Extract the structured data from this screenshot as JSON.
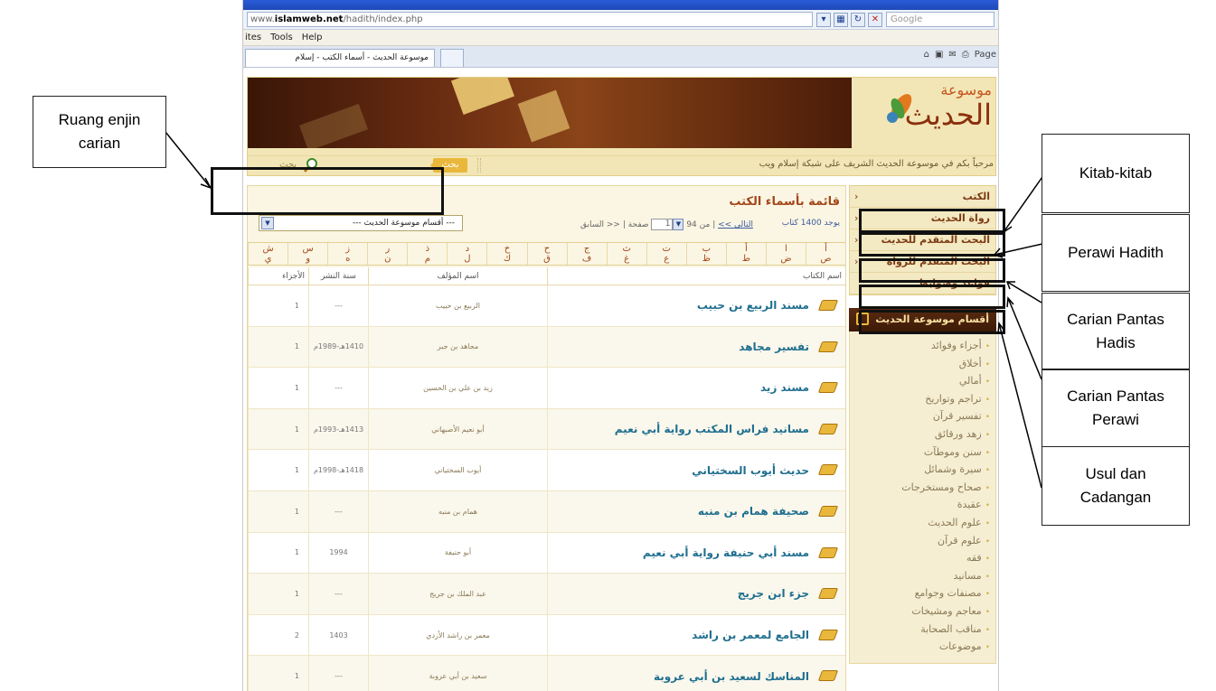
{
  "browser": {
    "url_prefix": "www.",
    "url_domain": "islamweb.net",
    "url_path": "/hadith/index.php",
    "search_placeholder": "Google",
    "menu": [
      "ites",
      "Tools",
      "Help"
    ],
    "tab_title": "موسوعة الحديث - أسماء الكتب - إسلام",
    "toolbar_page": "Page"
  },
  "header": {
    "logo_small": "موسوعة",
    "logo_big": "الحديث",
    "welcome": "مرحباً بكم في موسوعة الحديث الشريف على شبكة إسلام ويب",
    "search_button": "بحث",
    "search_field": "بحث"
  },
  "sidebar": {
    "items": [
      {
        "label": "الكتب"
      },
      {
        "label": "رواة الحديث"
      },
      {
        "label": "البحث المتقدم للحديث"
      },
      {
        "label": "البحث المتقدم للرواة"
      },
      {
        "label": "قواعد وضوابط"
      }
    ],
    "section_title": "أقسام موسوعة الحديث",
    "categories": [
      "أجزاء وفوائد",
      "أخلاق",
      "أمالي",
      "تراجم وتواريخ",
      "تفسير قرآن",
      "زهد ورقائق",
      "سنن وموطآت",
      "سيرة وشمائل",
      "صحاح ومستخرجات",
      "عقيدة",
      "علوم الحديث",
      "علوم قرآن",
      "فقه",
      "مسانيد",
      "مصنفات وجوامع",
      "معاجم ومشيخات",
      "مناقب الصحابة",
      "موضوعات"
    ]
  },
  "main": {
    "title": "قائمة بأسماء الكتب",
    "count": "يوجد 1400 كتاب",
    "pager": {
      "prev": "<< السابق",
      "page_label": "صفحة",
      "page_value": "1",
      "of": "من 94",
      "next": "التالي >>"
    },
    "category_select": "--- أقسام موسوعة الحديث ---",
    "alphabet_top": [
      "أ",
      "ا",
      "أ",
      "ب",
      "ت",
      "ث",
      "ج",
      "ح",
      "خ",
      "د",
      "ذ",
      "ر",
      "ز",
      "س",
      "ش"
    ],
    "alphabet_bottom": [
      "ص",
      "ض",
      "ط",
      "ظ",
      "ع",
      "غ",
      "ف",
      "ق",
      "ك",
      "ل",
      "م",
      "ن",
      "ه",
      "و",
      "ي"
    ],
    "columns": {
      "name": "اسم الكتاب",
      "author": "اسم المؤلف",
      "year": "سنة النشر",
      "parts": "الأجزاء"
    },
    "rows": [
      {
        "name": "مسند الربيع بن حبيب",
        "author": "الربيع بن حبيب",
        "year": "---",
        "parts": "1"
      },
      {
        "name": "تفسير مجاهد",
        "author": "مجاهد بن جبر",
        "year": "1410هـ-1989م",
        "parts": "1"
      },
      {
        "name": "مسند زيد",
        "author": "زيد بن علي بن الحسين",
        "year": "---",
        "parts": "1"
      },
      {
        "name": "مسانيد فراس المكتب رواية أبي نعيم",
        "author": "أبو نعيم الأصبهاني",
        "year": "1413هـ-1993م",
        "parts": "1"
      },
      {
        "name": "حديث أيوب السختياني",
        "author": "أيوب السختياني",
        "year": "1418هـ-1998م",
        "parts": "1"
      },
      {
        "name": "صحيفة همام بن منبه",
        "author": "همام بن منبه",
        "year": "---",
        "parts": "1"
      },
      {
        "name": "مسند أبي حنيفة رواية أبي نعيم",
        "author": "أبو حنيفة",
        "year": "1994",
        "parts": "1"
      },
      {
        "name": "جزء ابن جريج",
        "author": "عبد الملك بن جريج",
        "year": "---",
        "parts": "1"
      },
      {
        "name": "الجامع لمعمر بن راشد",
        "author": "معمر بن راشد الأزدي",
        "year": "1403",
        "parts": "2"
      },
      {
        "name": "المناسك لسعيد بن أبي عروبة",
        "author": "سعيد بن أبي عروبة",
        "year": "---",
        "parts": "1"
      }
    ]
  },
  "annotations": {
    "search_space": "Ruang enjin\ncarian",
    "books": "Kitab-kitab",
    "narrators": "Perawi Hadith",
    "quick_hadith": "Carian Pantas\nHadis",
    "quick_narrator": "Carian Pantas\nPerawi",
    "rules": "Usul dan\nCadangan"
  },
  "colors": {
    "accent": "#a3471a",
    "banner_dark": "#3a1607",
    "gold": "#e9b73b",
    "link": "#1f6f8f"
  }
}
